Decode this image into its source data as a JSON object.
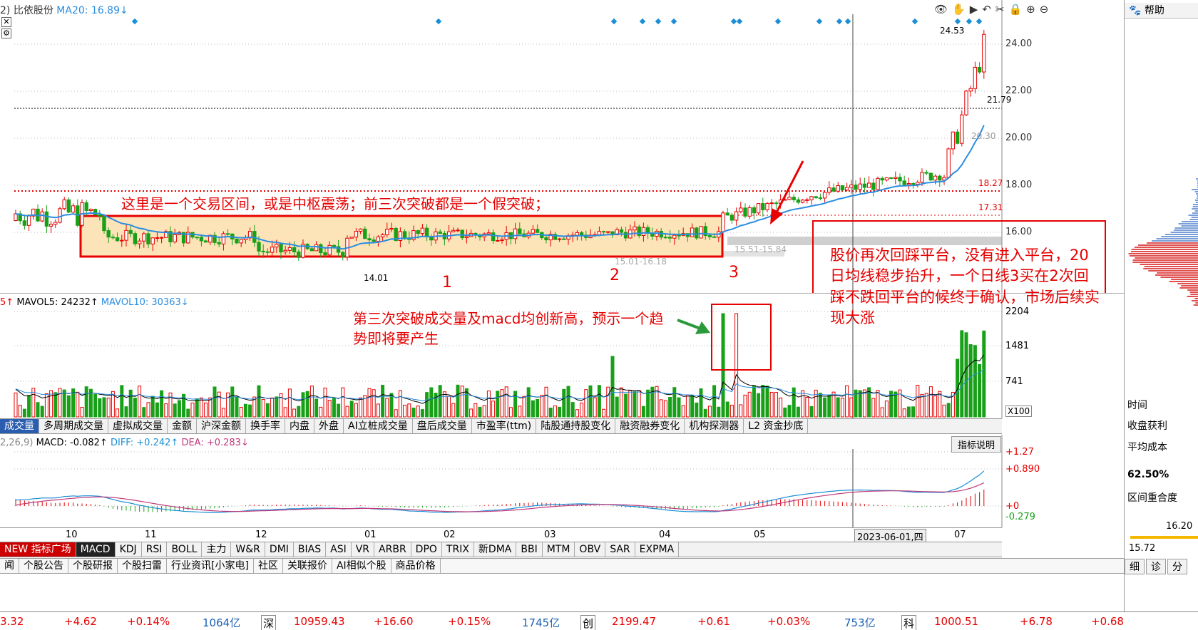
{
  "header": {
    "stock_label": "比依股份",
    "prefix": "2)",
    "ma20_label": "MA20: 16.89↓"
  },
  "help": {
    "label": "帮助"
  },
  "price_axis": {
    "labels": [
      "24.00",
      "22.00",
      "20.00",
      "18.00",
      "16.00"
    ]
  },
  "price_marks": {
    "high": "24.53",
    "last": "21.79",
    "level_1827": "18.27",
    "level_1731": "17.31",
    "level_2030": "20.30",
    "low": "14.01",
    "range_1": "15.51-15.84",
    "range_2": "15.01-16.18"
  },
  "annotations": {
    "range_note": "这里是一个交易区间，或是中枢震荡；前三次突破都是一个假突破；",
    "breakout_1": "1",
    "breakout_2": "2",
    "breakout_3": "3",
    "volume_note": "第三次突破成交量及macd均创新高，预示一个趋势即将要产生",
    "pullback_note": "股价再次回踩平台，没有进入平台，20日均线稳步抬升，一个日线3买在2次回踩不跌回平台的候终于确认，市场后续实现大涨"
  },
  "volume": {
    "legend_prefix": "5↑",
    "mavol5": "MAVOL5: 24232↑",
    "mavol10": "MAVOL10: 30363↓",
    "axis": [
      "2204",
      "1481",
      "741",
      "X100"
    ]
  },
  "volume_tabs": [
    "成交量",
    "多周期成交量",
    "虚拟成交量",
    "金额",
    "沪深金额",
    "换手率",
    "内盘",
    "外盘",
    "AI立桩成交量",
    "盘后成交量",
    "市盈率(ttm)",
    "陆股通持股变化",
    "融资融券变化",
    "机构探测器",
    "L2 资金抄底"
  ],
  "macd": {
    "params": "2,26,9)",
    "macd": "MACD: -0.082↑",
    "diff": "DIFF: +0.242↑",
    "dea": "DEA: +0.283↓",
    "explain_button": "指标说明",
    "axis": [
      "+1.27",
      "+0.890",
      "+0",
      "-0.279"
    ]
  },
  "time_axis": {
    "labels": [
      "10",
      "11",
      "12",
      "01",
      "02",
      "03",
      "04",
      "05",
      "07"
    ],
    "cursor_date": "2023-06-01,四"
  },
  "indicator_tabs": [
    "NEW 指标广场",
    "MACD",
    "KDJ",
    "RSI",
    "BOLL",
    "主力",
    "W&R",
    "DMI",
    "BIAS",
    "ASI",
    "VR",
    "ARBR",
    "DPO",
    "TRIX",
    "新DMA",
    "BBI",
    "MTM",
    "OBV",
    "SAR",
    "EXPMA"
  ],
  "bottom_tabs": [
    "闻",
    "个股公告",
    "个股研报",
    "个股扫雷",
    "行业资讯[小家电]",
    "社区",
    "关联报价",
    "AI相似个股",
    "商品价格"
  ],
  "ticker": {
    "sh_value": "3.32",
    "sh_change": "+4.62",
    "sh_pct": "+0.14%",
    "sh_amount": "1064亿",
    "sz_label": "深",
    "sz_value": "10959.43",
    "sz_change": "+16.60",
    "sz_pct": "+0.15%",
    "sz_amount": "1745亿",
    "cy_label": "创",
    "cy_value": "2199.47",
    "cy_change": "+0.61",
    "cy_pct": "+0.03%",
    "cy_amount": "753亿",
    "kc_label": "科",
    "kc_value": "1000.51",
    "kc_change": "+6.78",
    "kc_pct": "+0.68"
  },
  "side_panel": {
    "time_label": "时间",
    "profit_label": "收盘获利",
    "avg_cost_label": "平均成本",
    "profit_pct": "62.50%",
    "overlap_label": "区间重合度",
    "cost_high": "16.20",
    "cost_low": "15.72",
    "bottom_buttons": [
      "细",
      "诊",
      "分"
    ]
  },
  "colors": {
    "up": "#e60000",
    "down": "#18a018",
    "ma20": "#2a8de0",
    "note": "#e60000"
  }
}
